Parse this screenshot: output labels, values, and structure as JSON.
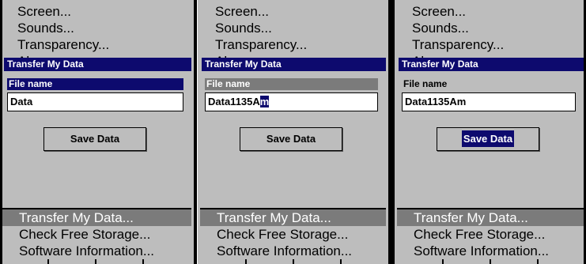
{
  "menu_top": [
    "Screen...",
    "Sounds...",
    "Transparency...",
    "Alarms..."
  ],
  "menu_bottom": [
    "Transfer My Data...",
    "Check Free Storage...",
    "Software Information..."
  ],
  "panels": [
    {
      "dialog_title": "Transfer My Data",
      "field_label": "File name",
      "input_before_cursor": "Data",
      "input_cursor": "",
      "button_label": "Save Data"
    },
    {
      "dialog_title": "Transfer My Data",
      "field_label": "File name",
      "input_before_cursor": "Data1135A",
      "input_cursor": "m",
      "button_label": "Save Data"
    },
    {
      "dialog_title": "Transfer My Data",
      "field_label": "File name",
      "input_before_cursor": "Data1135Am",
      "input_cursor": "",
      "button_label": "Save Data"
    }
  ],
  "colors": {
    "title_bar": "#0d0a6e",
    "panel_bg": "#bdbdbd",
    "selected": "#7b7b7b"
  }
}
